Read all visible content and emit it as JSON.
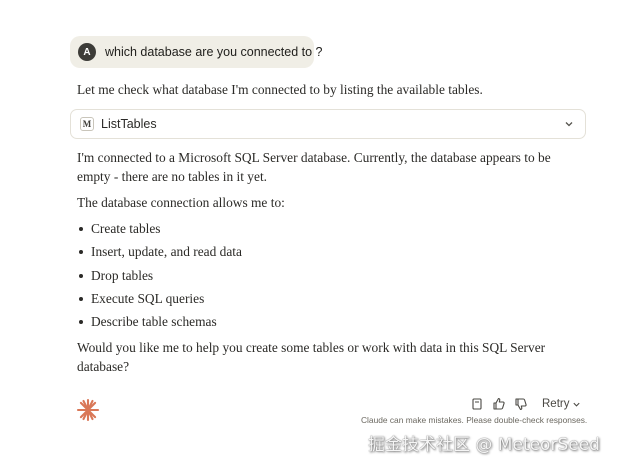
{
  "user": {
    "avatar_initial": "A",
    "message": "which database are you connected to ?"
  },
  "assistant": {
    "intro": "Let me check what database I'm connected to by listing the available tables.",
    "tool": {
      "icon_letter": "M",
      "label": "ListTables"
    },
    "result": "I'm connected to a Microsoft SQL Server database. Currently, the database appears to be empty - there are no tables in it yet.",
    "capabilities_heading": "The database connection allows me to:",
    "capabilities": [
      "Create tables",
      "Insert, update, and read data",
      "Drop tables",
      "Execute SQL queries",
      "Describe table schemas"
    ],
    "closing": "Would you like me to help you create some tables or work with data in this SQL Server database?"
  },
  "actions": {
    "retry_label": "Retry",
    "disclaimer": "Claude can make mistakes. Please double-check responses."
  },
  "icons": {
    "copy": "copy-icon",
    "thumbs_up": "thumbs-up-icon",
    "thumbs_down": "thumbs-down-icon",
    "logo": "claude-spark-icon"
  },
  "colors": {
    "accent": "#d97757",
    "user_bubble": "#f0eee6"
  },
  "watermark": "掘金技术社区 @ MeteorSeed"
}
